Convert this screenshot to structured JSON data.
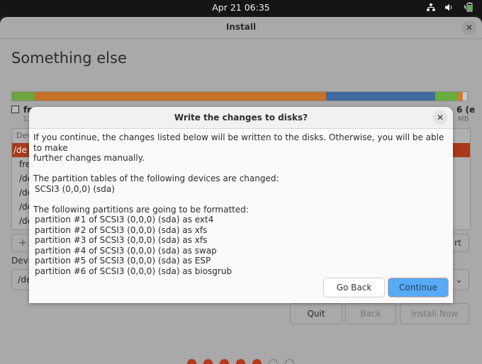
{
  "topbar": {
    "clock": "Apr 21  06:35",
    "tray_icons": [
      "network-icon",
      "volume-icon",
      "battery-icon"
    ]
  },
  "window": {
    "title": "Install",
    "heading": "Something else",
    "partition_bar": [
      {
        "color": "#6ea540",
        "fraction": 0.05
      },
      {
        "color": "#c57128",
        "fraction": 0.64
      },
      {
        "color": "#3f6a9d",
        "fraction": 0.24
      },
      {
        "color": "#6aad3e",
        "fraction": 0.05
      },
      {
        "color": "#d37a32",
        "fraction": 0.01
      },
      {
        "color": "#c9c9c9",
        "fraction": 0.01
      }
    ],
    "legend_first": "fr",
    "legend_first_sub": "1.",
    "legend_last": "6 (e",
    "legend_last_sub": "MB",
    "table": {
      "header": "Dev",
      "rows": [
        "/de",
        "fre",
        "/de",
        "/de",
        "/de",
        "/de"
      ],
      "selected_index": 0
    },
    "add_button": "+",
    "partial_right_button": "rt",
    "device_label": "Devi",
    "device_select_value": "/de",
    "buttons": {
      "quit": "Quit",
      "back": "Back",
      "install_now": "Install Now"
    },
    "progress": {
      "completed_steps": 5,
      "total_steps": 7
    }
  },
  "dialog": {
    "title": "Write the changes to disks?",
    "intro_line1": "If you continue, the changes listed below will be written to the disks. Otherwise, you will be able to make",
    "intro_line2": "further changes manually.",
    "tables_heading": "The partition tables of the following devices are changed:",
    "tables_devices": [
      "SCSI3 (0,0,0) (sda)"
    ],
    "format_heading": "The following partitions are going to be formatted:",
    "format_items": [
      "partition #1 of SCSI3 (0,0,0) (sda) as ext4",
      "partition #2 of SCSI3 (0,0,0) (sda) as xfs",
      "partition #3 of SCSI3 (0,0,0) (sda) as xfs",
      "partition #4 of SCSI3 (0,0,0) (sda) as swap",
      "partition #5 of SCSI3 (0,0,0) (sda) as ESP",
      "partition #6 of SCSI3 (0,0,0) (sda) as biosgrub"
    ],
    "go_back_label": "Go Back",
    "continue_label": "Continue"
  }
}
